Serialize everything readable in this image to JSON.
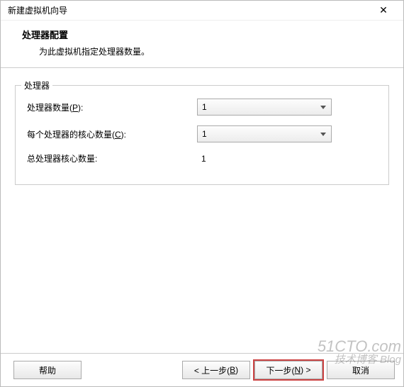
{
  "titlebar": {
    "title": "新建虚拟机向导",
    "close": "✕"
  },
  "header": {
    "title": "处理器配置",
    "desc": "为此虚拟机指定处理器数量。"
  },
  "fieldset": {
    "legend": "处理器",
    "rows": {
      "count_label_pre": "处理器数量(",
      "count_label_hot": "P",
      "count_label_post": "):",
      "count_value": "1",
      "cores_label_pre": "每个处理器的核心数量(",
      "cores_label_hot": "C",
      "cores_label_post": "):",
      "cores_value": "1",
      "total_label": "总处理器核心数量:",
      "total_value": "1"
    }
  },
  "footer": {
    "help": "帮助",
    "back_pre": "< 上一步(",
    "back_hot": "B",
    "back_post": ")",
    "next_pre": "下一步(",
    "next_hot": "N",
    "next_post": ") >",
    "cancel": "取消"
  },
  "watermark": {
    "line1": "51CTO.com",
    "line2": "技术博客 Blog"
  }
}
